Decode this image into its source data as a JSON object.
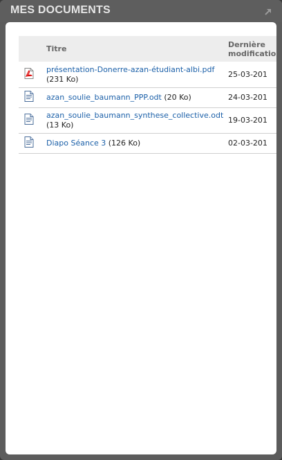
{
  "header": {
    "title": "MES DOCUMENTS",
    "expand_icon": "expand-arrow-icon"
  },
  "table": {
    "columns": [
      "Titre",
      "Dernière modification"
    ],
    "rows": [
      {
        "icon": "pdf-file-icon",
        "name": "présentation-Donerre-azan-étudiant-albi.pdf",
        "size": "(231 Ko)",
        "date": "25-03-201"
      },
      {
        "icon": "text-document-icon",
        "name": "azan_soulie_baumann_PPP.odt",
        "size": "(20 Ko)",
        "date": "24-03-201"
      },
      {
        "icon": "text-document-icon",
        "name": "azan_soulie_baumann_synthese_collective.odt",
        "size": "(13 Ko)",
        "date": "19-03-201"
      },
      {
        "icon": "text-document-icon",
        "name": "Diapo Séance 3",
        "size": "(126 Ko)",
        "date": "02-03-201"
      }
    ]
  },
  "colors": {
    "panel": "#5c5c5c",
    "link": "#1a5fa8",
    "header_row": "#ededed"
  }
}
